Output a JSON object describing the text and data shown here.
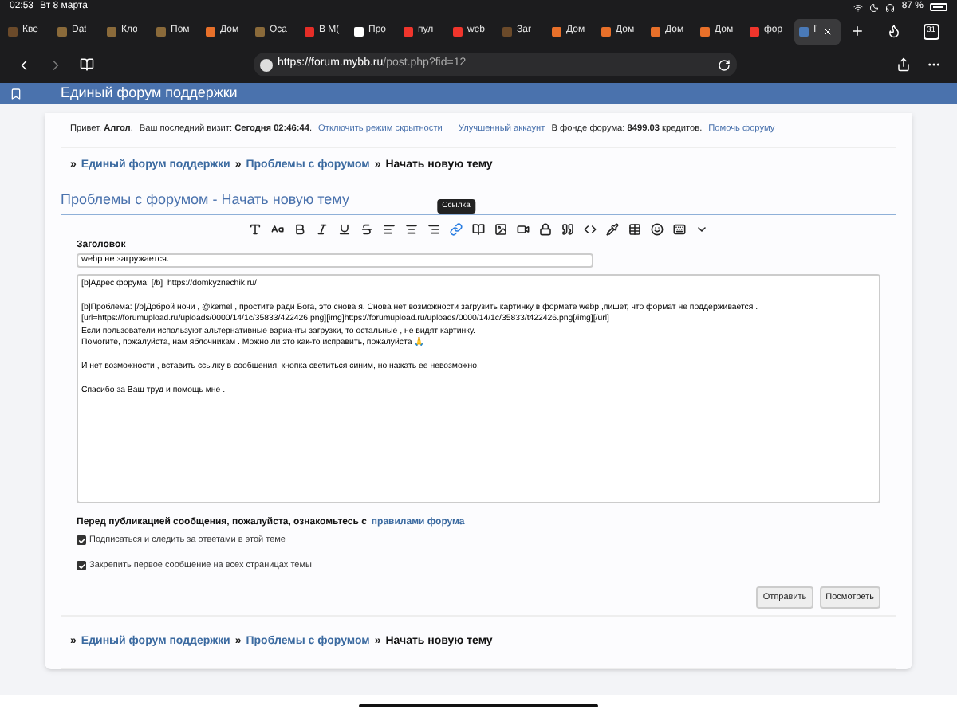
{
  "status_bar": {
    "time": "02:53",
    "date": "Вт 8 марта",
    "battery": "87 %"
  },
  "browser": {
    "tabs": [
      {
        "label": "Кве",
        "color": "#6b4a2a",
        "selected": false
      },
      {
        "label": "Dat",
        "color": "#8a6a3a",
        "selected": false
      },
      {
        "label": "Кло",
        "color": "#8a6a3a",
        "selected": false
      },
      {
        "label": "Пом",
        "color": "#8a6a3a",
        "selected": false
      },
      {
        "label": "Дом",
        "color": "#e8702a",
        "selected": false
      },
      {
        "label": "Оса",
        "color": "#8a6a3a",
        "selected": false
      },
      {
        "label": "В М(",
        "color": "#e52d27",
        "selected": false
      },
      {
        "label": "Про",
        "color": "#ffffff",
        "selected": false
      },
      {
        "label": "пул",
        "color": "#f0352c",
        "selected": false
      },
      {
        "label": "web",
        "color": "#f0352c",
        "selected": false
      },
      {
        "label": "Заг",
        "color": "#6b4a2a",
        "selected": false
      },
      {
        "label": "Дом",
        "color": "#e8702a",
        "selected": false
      },
      {
        "label": "Дом",
        "color": "#e8702a",
        "selected": false
      },
      {
        "label": "Дом",
        "color": "#e8702a",
        "selected": false
      },
      {
        "label": "Дом",
        "color": "#e8702a",
        "selected": false
      },
      {
        "label": "фор",
        "color": "#f0352c",
        "selected": false
      },
      {
        "label": "I'",
        "color": "#4a7ab8",
        "selected": true
      }
    ],
    "tab_count": "31",
    "url_host": "https://forum.mybb.ru",
    "url_path": "/post.php?fid=12"
  },
  "forum_header": {
    "title": "Единый форум поддержки"
  },
  "welcome": {
    "greeting": "Привет, **Алгол**.",
    "last_visit": "Ваш последний визит: **Сегодня 02:46:44**.",
    "stealth_link": "Отключить режим скрытности",
    "premium_link": "Улучшенный аккаунт",
    "fund": "В фонде форума: **8499.03** кредитов.",
    "help_link": "Помочь форуму"
  },
  "breadcrumbs": [
    {
      "sep": "»",
      "label": "Единый форум поддержки",
      "link": true
    },
    {
      "sep": "»",
      "label": "Проблемы с форумом",
      "link": true
    },
    {
      "sep": "»",
      "label": "Начать новую тему",
      "link": false
    }
  ],
  "page_title": "Проблемы с форумом - Начать новую тему",
  "toolbar": {
    "tooltip": "Ссылка",
    "buttons": [
      {
        "hovered": false
      },
      {
        "hovered": false
      },
      {
        "hovered": false
      },
      {
        "hovered": false
      },
      {
        "hovered": false
      },
      {
        "hovered": false
      },
      {
        "hovered": false
      },
      {
        "hovered": false
      },
      {
        "hovered": false
      },
      {
        "hovered": true
      },
      {
        "hovered": false
      },
      {
        "hovered": false
      },
      {
        "hovered": false
      },
      {
        "hovered": false
      },
      {
        "hovered": false
      },
      {
        "hovered": false
      },
      {
        "hovered": false
      },
      {
        "hovered": false
      },
      {
        "hovered": false
      },
      {
        "hovered": false
      },
      {
        "hovered": false
      }
    ]
  },
  "subject": {
    "label": "Заголовок",
    "value": "webp не загружается."
  },
  "message": {
    "value": "[b]Адрес форума: [/b]  https://domkyznechik.ru/\n\n[b]Проблема: [/b]Доброй ночи , @kemel , простите ради Бога, это снова я. Снова нет возможности загрузить картинку в формате webp ,пишет, что формат не поддерживается .\n[url=https://forumupload.ru/uploads/0000/14/1c/35833/422426.png][img]https://forumupload.ru/uploads/0000/14/1c/35833/t422426.png[/img][/url]\nЕсли пользователи используют альтернативные варианты загрузки, то остальные , не видят картинку.\nПомогите, пожалуйста, нам яблочникам . Можно ли это как-то исправить, пожалуйста 🙏\n\nИ нет возможности , вставить ссылку в сообщения, кнопка светиться синим, но нажать ее невозможно.\n\nСпасибо за Ваш труд и помощь мне ."
  },
  "notice": {
    "text": "Перед публикацией сообщения, пожалуйста, ознакомьтесь с",
    "link": "правилами форума"
  },
  "options": [
    {
      "label": "Подписаться и следить за ответами в этой теме",
      "checked": true
    },
    {
      "label": "Закрепить первое сообщение на всех страницах темы",
      "checked": true
    }
  ],
  "buttons": [
    "Отправить",
    "Посмотреть"
  ],
  "footer_breadcrumbs": [
    {
      "sep": "»",
      "label": "Единый форум поддержки",
      "link": true
    },
    {
      "sep": "»",
      "label": "Проблемы с форумом",
      "link": true
    },
    {
      "sep": "»",
      "label": "Начать новую тему",
      "link": false
    }
  ]
}
